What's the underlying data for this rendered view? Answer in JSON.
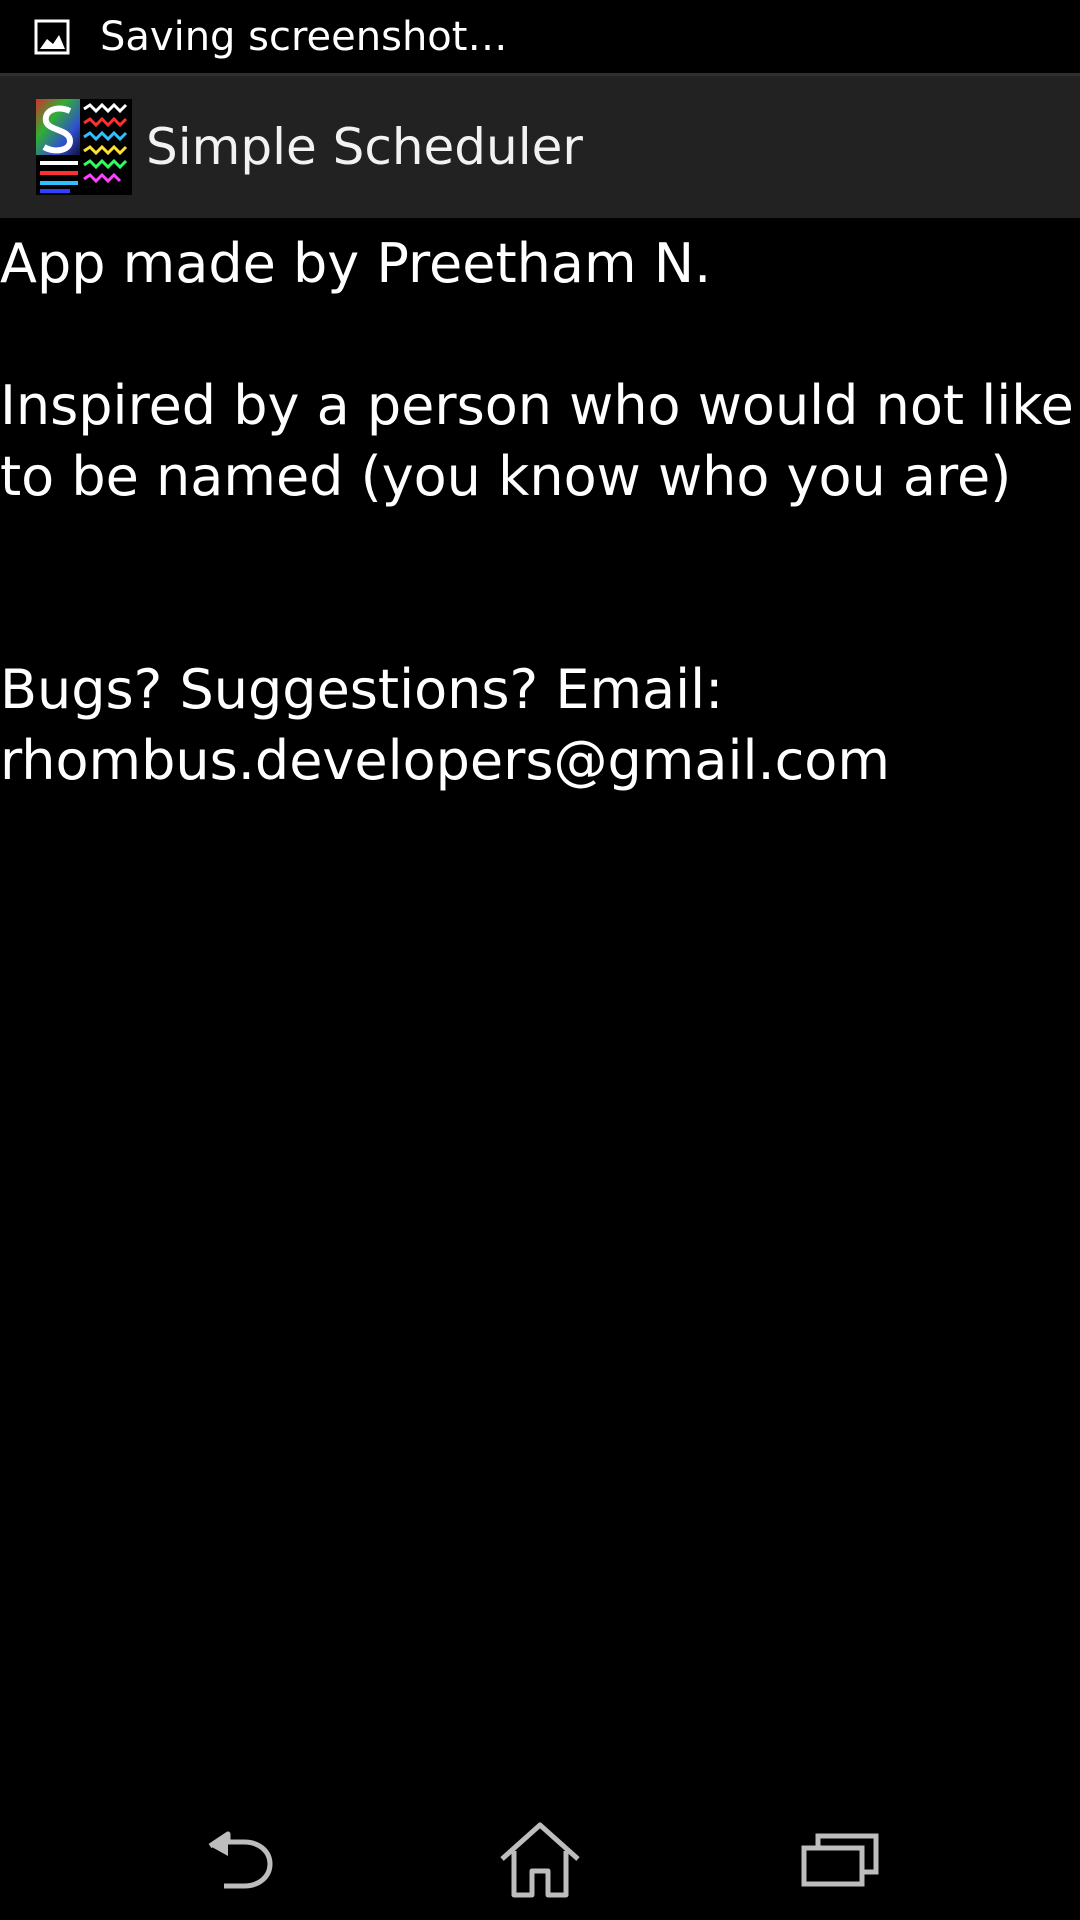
{
  "status_bar": {
    "notification_text": "Saving screenshot…",
    "icon": "image-icon"
  },
  "action_bar": {
    "app_title": "Simple Scheduler",
    "logo_icon": "simple-scheduler-logo"
  },
  "content": {
    "line_author": "App made by Preetham N.",
    "line_inspired": "Inspired by a person who would not like to be named (you know who you are)",
    "line_contact_label": "Bugs? Suggestions? Email:",
    "line_email": "rhombus.developers@gmail.com"
  },
  "nav_bar": {
    "back_icon": "back-icon",
    "home_icon": "home-icon",
    "recents_icon": "recent-apps-icon"
  },
  "colors": {
    "background": "#000000",
    "action_bar": "#222222",
    "text": "#ffffff",
    "nav_icon": "#bdbdbd"
  }
}
